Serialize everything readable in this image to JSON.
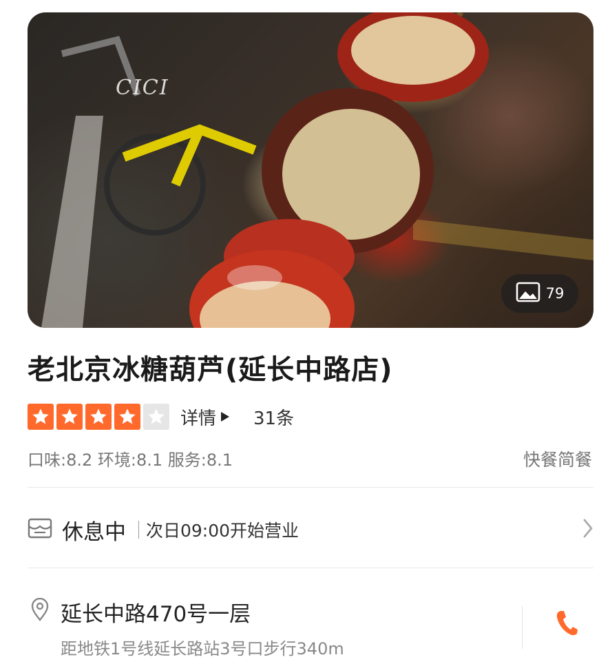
{
  "hero": {
    "watermark": "CICI",
    "photo_count": "79",
    "icon": "image-icon"
  },
  "shop": {
    "title": "老北京冰糖葫芦(延长中路店)",
    "rating_stars": 4,
    "rating_max": 5,
    "detail_label": "详情",
    "review_count": "31条",
    "scores": "口味:8.2 环境:8.1 服务:8.1",
    "category": "快餐简餐"
  },
  "hours": {
    "icon": "store-icon",
    "status": "休息中",
    "text": "次日09:00开始营业"
  },
  "address": {
    "icon": "location-pin-icon",
    "line": "延长中路470号一层",
    "metro": "距地铁1号线延长路站3号口步行340m",
    "phone_icon": "phone-icon"
  },
  "colors": {
    "accent": "#ff6a2c",
    "star_off": "#e6e6e6",
    "secondary_text": "#777777"
  }
}
